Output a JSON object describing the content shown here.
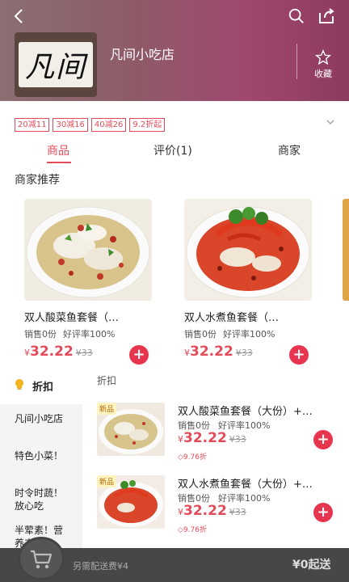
{
  "colors": {
    "accent": "#e44b5a",
    "hero_start": "#8a6f73",
    "hero_end": "#8e3a5e",
    "discount_badge": "#fff3c0"
  },
  "header": {
    "back_icon": "back-icon",
    "search_icon": "search-icon",
    "share_icon": "share-icon",
    "logo_text": "凡间",
    "shop_name": "凡间小吃店",
    "favorite_label": "收藏",
    "favorite_icon": "star-icon"
  },
  "coupons": [
    "20减11",
    "30减16",
    "40减26",
    "9.2折起"
  ],
  "tabs": [
    {
      "label": "商品",
      "active": true
    },
    {
      "label": "评价(1)",
      "active": false
    },
    {
      "label": "商家",
      "active": false
    }
  ],
  "recommend": {
    "title": "商家推荐",
    "items": [
      {
        "name": "双人酸菜鱼套餐（…",
        "sales": "销售0份",
        "rating": "好评率100%",
        "currency": "¥",
        "price": "32.22",
        "old_price": "¥33"
      },
      {
        "name": "双人水煮鱼套餐（…",
        "sales": "销售0份",
        "rating": "好评率100%",
        "currency": "¥",
        "price": "32.22",
        "old_price": "¥33"
      }
    ]
  },
  "sidebar": {
    "active": "折扣",
    "items": [
      "凡间小吃店",
      "特色小菜！",
      "时令时蔬！放心吃",
      "半荤素！营养丰富"
    ]
  },
  "list": {
    "title": "折扣",
    "items": [
      {
        "badge": "新品",
        "name": "双人酸菜鱼套餐（大份）+…",
        "sales": "销售0份",
        "rating": "好评率100%",
        "currency": "¥",
        "price": "32.22",
        "old_price": "¥33",
        "discount": "9.76折"
      },
      {
        "badge": "新品",
        "name": "双人水煮鱼套餐（大份）+…",
        "sales": "销售0份",
        "rating": "好评率100%",
        "currency": "¥",
        "price": "32.22",
        "old_price": "¥33",
        "discount": "9.76折"
      }
    ]
  },
  "cart": {
    "icon": "shopping-cart-icon",
    "delivery_fee": "另需配送费¥4",
    "min_order": "¥0起送"
  }
}
